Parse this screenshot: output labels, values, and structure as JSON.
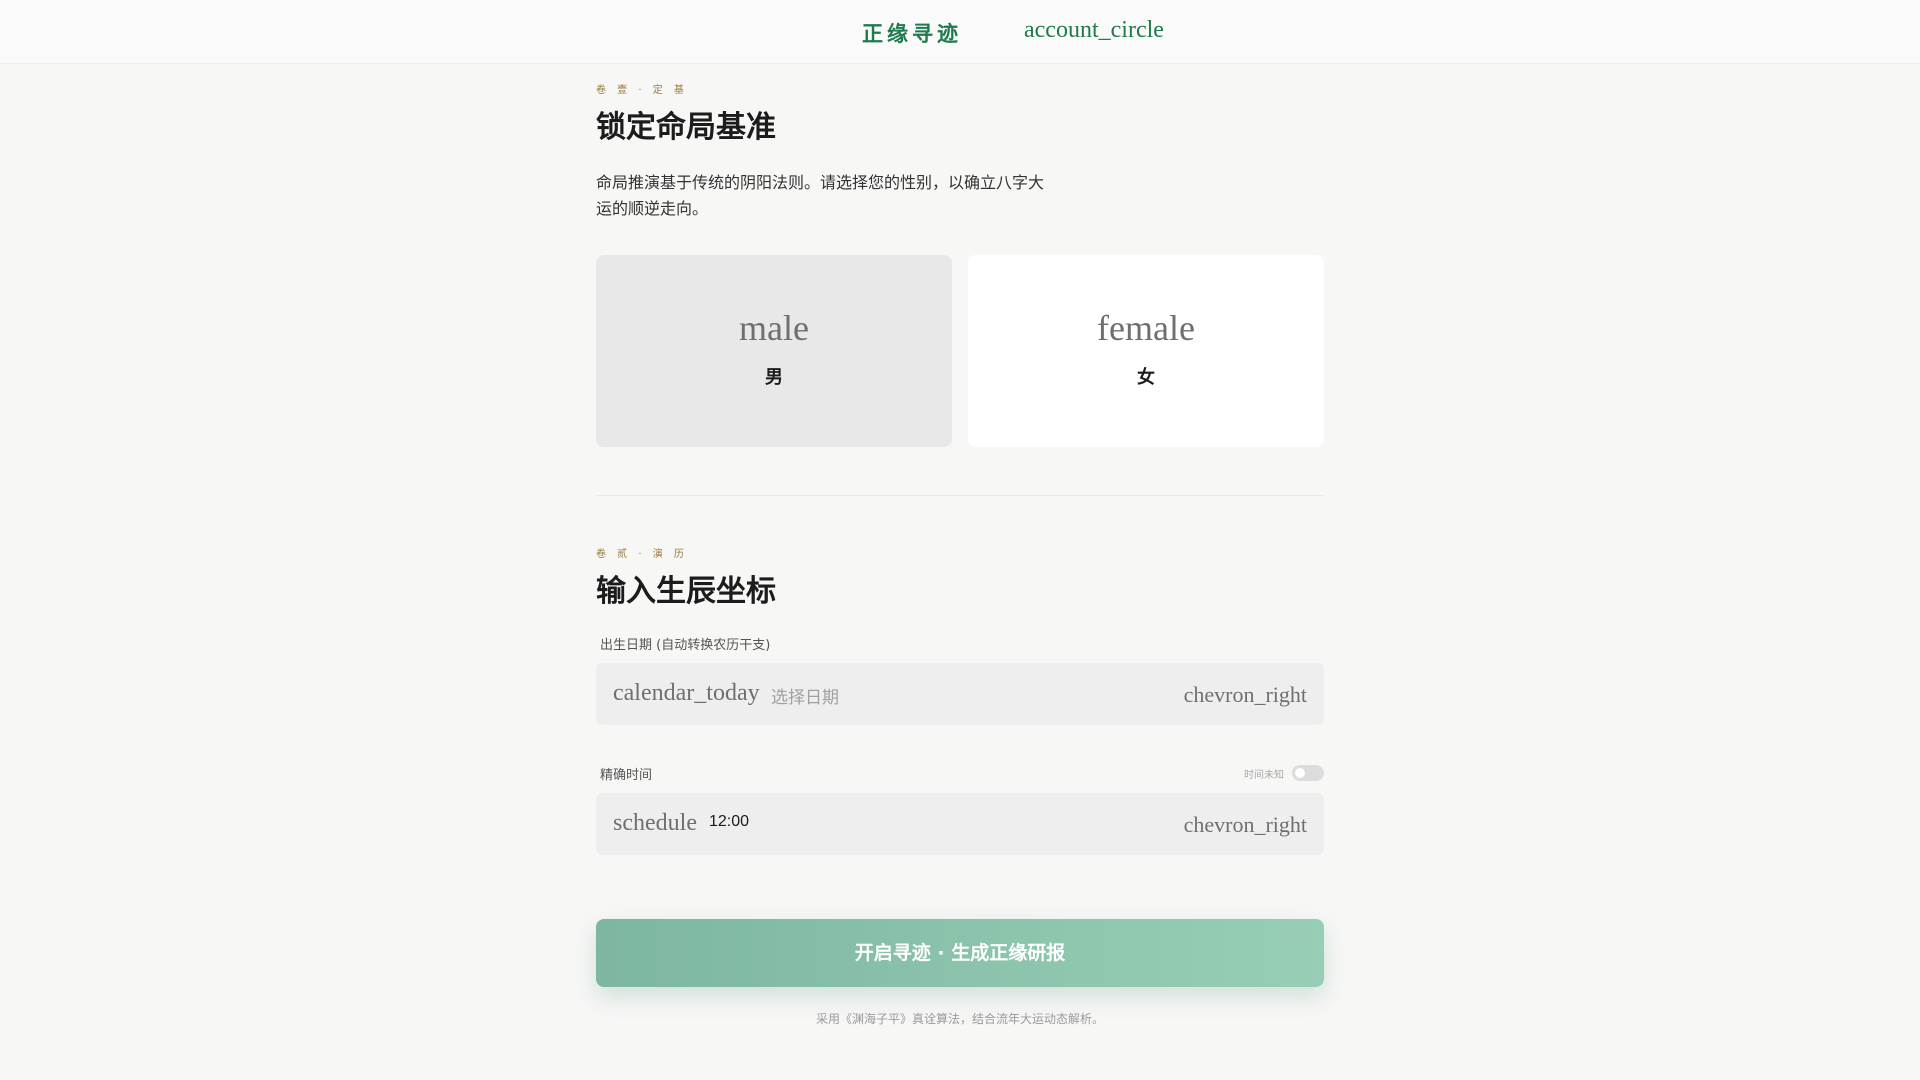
{
  "header": {
    "brand": "正缘寻迹",
    "account_icon": "account_circle"
  },
  "section1": {
    "kicker": "卷 壹 · 定 基",
    "title": "锁定命局基准",
    "description": "命局推演基于传统的阴阳法则。请选择您的性别，以确立八字大运的顺逆走向。",
    "options": [
      {
        "icon": "male",
        "label": "男",
        "selected": true
      },
      {
        "icon": "female",
        "label": "女",
        "selected": false
      }
    ]
  },
  "section2": {
    "kicker": "卷 贰 · 演 历",
    "title": "输入生辰坐标",
    "date": {
      "label": "出生日期 (自动转换农历干支)",
      "icon": "calendar_today",
      "placeholder": "选择日期",
      "chevron": "chevron_right"
    },
    "time": {
      "label": "精确时间",
      "unknown_label": "时间未知",
      "unknown_checked": false,
      "icon": "schedule",
      "value": "12:00",
      "chevron": "chevron_right"
    }
  },
  "submit_label": "开启寻迹 · 生成正缘研报",
  "footnote": "采用《渊海子平》真诠算法，结合流年大运动态解析。"
}
